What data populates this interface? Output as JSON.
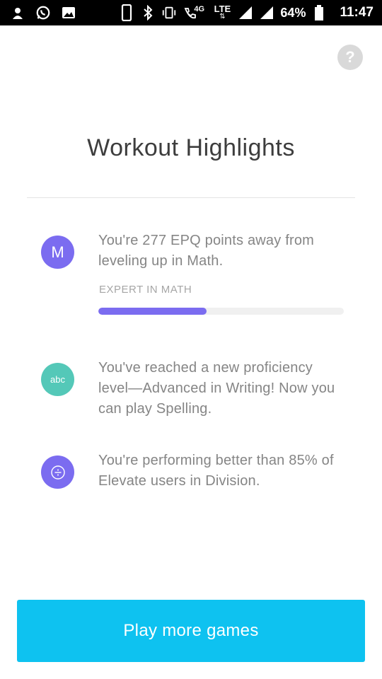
{
  "status_bar": {
    "network_label": "4G",
    "lte_label": "LTE",
    "battery_percent": "64%",
    "time": "11:47",
    "icons": [
      "cat-notification-icon",
      "whatsapp-icon",
      "gallery-icon",
      "phone-icon",
      "bluetooth-icon",
      "vibrate-icon",
      "call-icon",
      "signal-icon",
      "signal-icon-2",
      "battery-icon"
    ]
  },
  "help": {
    "label": "?"
  },
  "page": {
    "title": "Workout Highlights"
  },
  "highlights": [
    {
      "icon_text": "M",
      "icon_color": "#7b6cf0",
      "text": "You're 277 EPQ points away from leveling up in Math.",
      "label": "EXPERT IN MATH",
      "progress": 0.44,
      "progress_color": "#7b6cf0"
    },
    {
      "icon_text": "abc",
      "icon_color": "#54c8b8",
      "text": "You've reached a new proficiency level—Advanced in Writing! Now you can play Spelling."
    },
    {
      "icon_text": "÷",
      "icon_color": "#7b6cf0",
      "icon": "division-icon",
      "text": "You're performing better than 85% of Elevate users in Division."
    }
  ],
  "cta": {
    "label": "Play more games",
    "color": "#0ec2f0"
  }
}
